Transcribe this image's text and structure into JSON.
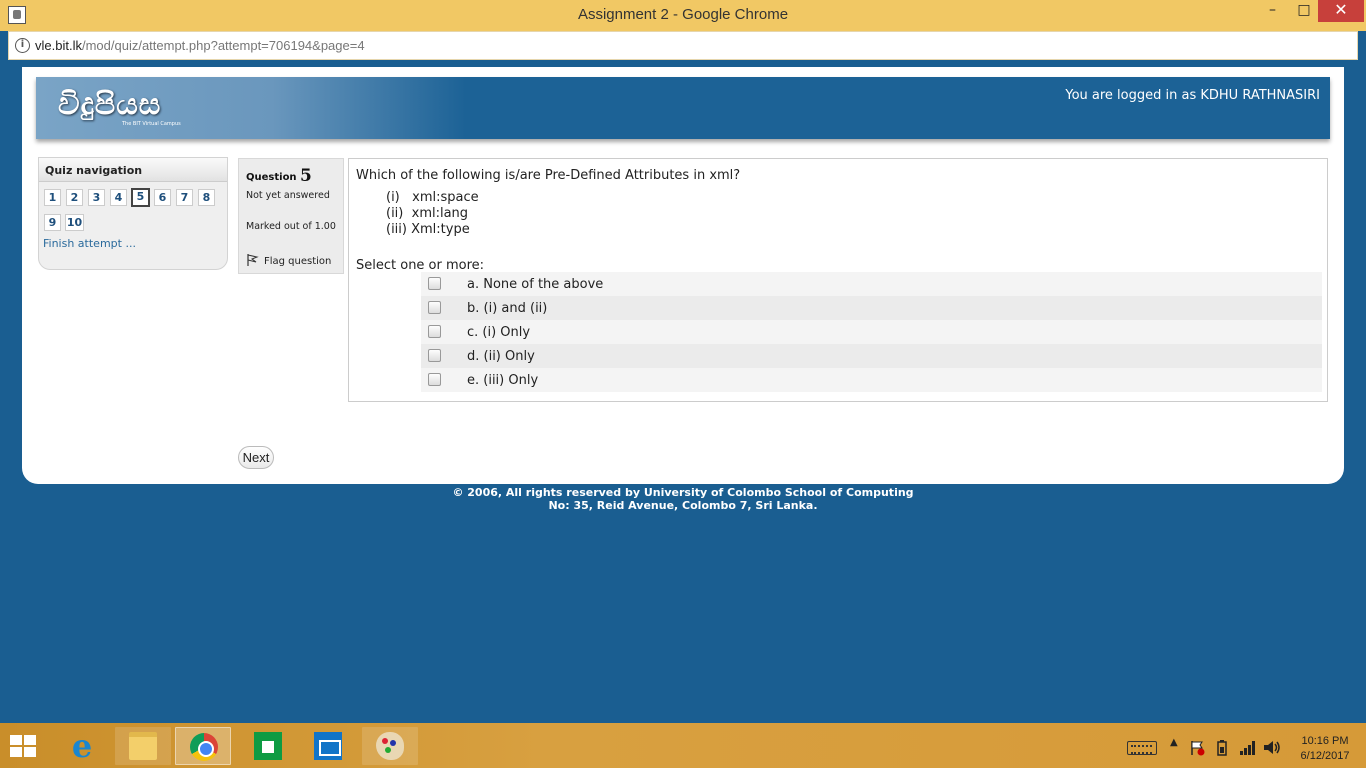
{
  "window": {
    "title": "Assignment 2 - Google Chrome",
    "minimize_label": "–",
    "maximize_label": "□",
    "close_label": "✕"
  },
  "address_bar": {
    "host": "vle.bit.lk",
    "path": "/mod/quiz/attempt.php?attempt=706194&page=4",
    "info_label": "i"
  },
  "header": {
    "logo_text": "විදුපියස",
    "logo_subtitle": "The BIT Virtual Campus",
    "login_text": "You are logged in as KDHU RATHNASIRI"
  },
  "quiz_nav": {
    "title": "Quiz navigation",
    "buttons": [
      "1",
      "2",
      "3",
      "4",
      "5",
      "6",
      "7",
      "8",
      "9",
      "10"
    ],
    "current": "5",
    "finish_label": "Finish attempt ..."
  },
  "question_info": {
    "label": "Question",
    "number": "5",
    "state": "Not yet answered",
    "grade": "Marked out of 1.00",
    "flag_label": "Flag question"
  },
  "question": {
    "text": "Which of the following is/are Pre-Defined Attributes in xml?",
    "items": [
      "(i)   xml:space",
      "(ii)  xml:lang",
      "(iii) Xml:type"
    ],
    "prompt": "Select one or more:",
    "answers": [
      {
        "label": "a. None of the above",
        "checked": false
      },
      {
        "label": "b. (i) and (ii)",
        "checked": false
      },
      {
        "label": "c. (i) Only",
        "checked": false
      },
      {
        "label": "d. (ii) Only",
        "checked": false
      },
      {
        "label": "e. (iii) Only",
        "checked": false
      }
    ]
  },
  "next_label": "Next",
  "footer": {
    "line1": "© 2006, All rights reserved by University of Colombo School of Computing",
    "line2": "No: 35, Reid Avenue, Colombo 7, Sri Lanka."
  },
  "taskbar": {
    "apps": [
      "start-icon",
      "internet-explorer-icon",
      "file-explorer-icon",
      "chrome-icon",
      "store-icon",
      "mail-icon",
      "paint-icon"
    ],
    "tray_up_label": "▲",
    "time": "10:16 PM",
    "date": "6/12/2017"
  },
  "colors": {
    "page_background": "#1a5e91",
    "title_bar": "#f1c864",
    "close_button": "#c7403b",
    "link": "#2a6a9c"
  }
}
